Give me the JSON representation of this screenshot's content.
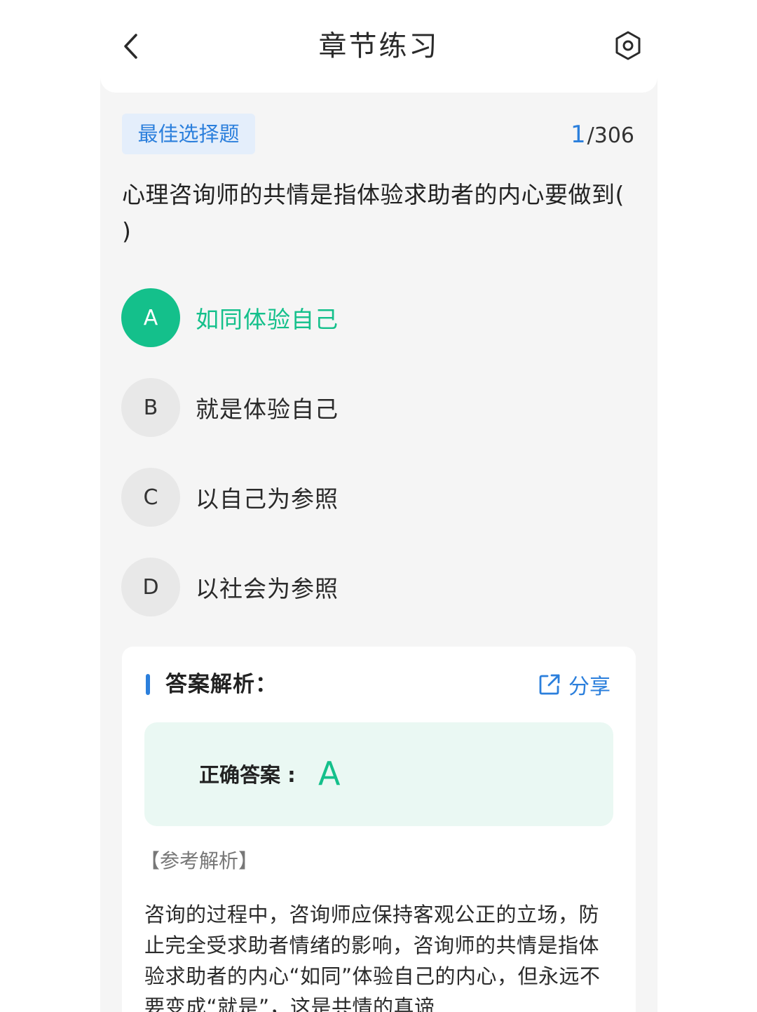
{
  "header": {
    "title": "章节练习",
    "back_icon": "chevron-left-icon",
    "settings_icon": "hexagon-settings-icon"
  },
  "question": {
    "type_label": "最佳选择题",
    "current": "1",
    "total": "/306",
    "text": "心理咨询师的共情是指体验求助者的内心要做到( )"
  },
  "options": [
    {
      "letter": "A",
      "text": "如同体验自己",
      "selected": true
    },
    {
      "letter": "B",
      "text": "就是体验自己",
      "selected": false
    },
    {
      "letter": "C",
      "text": "以自己为参照",
      "selected": false
    },
    {
      "letter": "D",
      "text": "以社会为参照",
      "selected": false
    }
  ],
  "analysis": {
    "title": "答案解析：",
    "share_label": "分享",
    "share_icon": "share-external-icon",
    "correct_label": "正确答案 :",
    "correct_value": "A",
    "ref_label": "【参考解析】",
    "ref_text": "咨询的过程中，咨询师应保持客观公正的立场，防止完全受求助者情绪的影响，咨询师的共情是指体验求助者的内心“如同”体验自己的内心，但永远不要变成“就是”，这是共情的真谛"
  },
  "colors": {
    "accent_blue": "#2b7fdc",
    "accent_green": "#14c08b",
    "answer_bg": "#eaf8f3"
  }
}
